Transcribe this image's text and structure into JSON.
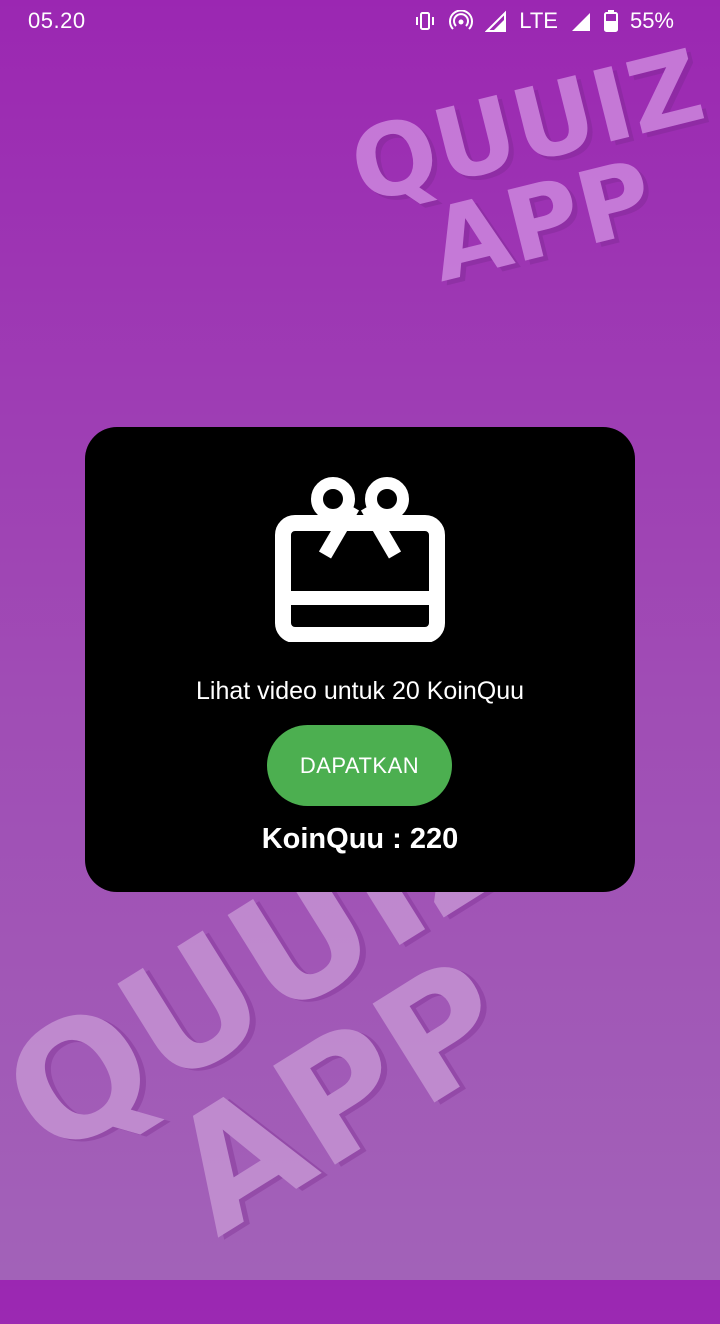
{
  "status_bar": {
    "time": "05.20",
    "network": "LTE",
    "battery": "55%",
    "icons": [
      "vibrate-icon",
      "hotspot-icon",
      "signal-icon",
      "signal-icon",
      "battery-icon"
    ]
  },
  "watermark": {
    "top_line1": "QUUIZ",
    "top_line2": "APP",
    "bottom_line1": "QUUIZ",
    "bottom_line2": "APP"
  },
  "reward_card": {
    "icon": "gift-card-icon",
    "message": "Lihat video untuk 20 KoinQuu",
    "button_label": "DAPATKAN",
    "coins_text": "KoinQuu : 220"
  },
  "colors": {
    "background_top": "#9b27b2",
    "background_bottom": "#a262b8",
    "card": "#000000",
    "button": "#4caf50"
  }
}
